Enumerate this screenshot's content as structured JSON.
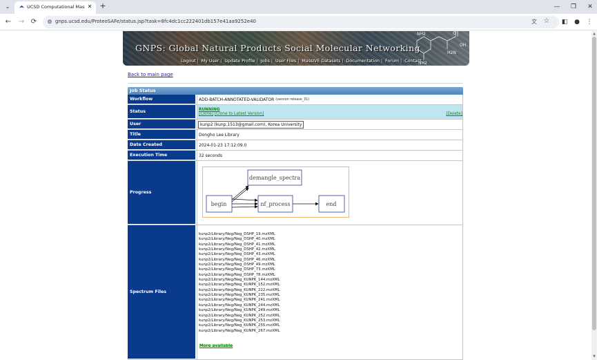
{
  "browser": {
    "tab_title": "UCSD Computational Mass Sp",
    "url": "gnps.ucsd.edu/ProteoSAFe/status.jsp?task=8fc4dc1cc222401db157e41aa9252e40"
  },
  "banner": {
    "title": "GNPS: Global Natural Products Social Molecular Networking",
    "nav": [
      "Logout",
      "My User",
      "Update Profile",
      "Jobs",
      "User Files",
      "MassIVE Datasets",
      "Documentation",
      "Forum",
      "Contact"
    ],
    "mol_labels": {
      "nh2_top": "NH2",
      "oh": "OH",
      "h2n": "H2N",
      "o": "O",
      "nh2_bottom": "NH2"
    }
  },
  "back_link": "Back to main page",
  "job": {
    "header": "Job Status",
    "rows": {
      "workflow": {
        "label": "Workflow",
        "value": "ADD-BATCH-ANNOTATED-VALIDATOR",
        "version": "(version release_31)"
      },
      "status": {
        "label": "Status",
        "state": "RUNNING",
        "clone": "[Clone]",
        "clone_latest": "[Clone to Latest Version]",
        "delete": "[Delete]"
      },
      "user": {
        "label": "User",
        "value": "kunp2 (kunp.1513@gmail.com), Korea University"
      },
      "title": {
        "label": "Title",
        "value": "Dongho Lee Library"
      },
      "date": {
        "label": "Date Created",
        "value": "2024-01-23 17:12:09.0"
      },
      "exec": {
        "label": "Execution Time",
        "value": "32 seconds"
      },
      "progress": {
        "label": "Progress",
        "nodes": {
          "begin": "begin",
          "demangle": "demangle_spectra",
          "process": "nf_process",
          "end": "end"
        }
      },
      "files": {
        "label": "Spectrum Files",
        "more": "More available"
      }
    }
  },
  "spectrum_files": [
    "kunp2/Library/Neg/Neg_DSHP_19.mzXML",
    "kunp2/Library/Neg/Neg_DSHP_40.mzXML",
    "kunp2/Library/Neg/Neg_DSHP_41.mzXML",
    "kunp2/Library/Neg/Neg_DSHP_42.mzXML",
    "kunp2/Library/Neg/Neg_DSHP_43.mzXML",
    "kunp2/Library/Neg/Neg_DSHP_46.mzXML",
    "kunp2/Library/Neg/Neg_DSHP_49.mzXML",
    "kunp2/Library/Neg/Neg_DSHP_73.mzXML",
    "kunp2/Library/Neg/Neg_DSHP_78.mzXML",
    "kunp2/Library/Neg/Neg_KUNPK_144.mzXML",
    "kunp2/Library/Neg/Neg_KUNPK_152.mzXML",
    "kunp2/Library/Neg/Neg_KUNPK_222.mzXML",
    "kunp2/Library/Neg/Neg_KUNPK_235.mzXML",
    "kunp2/Library/Neg/Neg_KUNPK_241.mzXML",
    "kunp2/Library/Neg/Neg_KUNPK_244.mzXML",
    "kunp2/Library/Neg/Neg_KUNPK_249.mzXML",
    "kunp2/Library/Neg/Neg_KUNPK_252.mzXML",
    "kunp2/Library/Neg/Neg_KUNPK_253.mzXML",
    "kunp2/Library/Neg/Neg_KUNPK_255.mzXML",
    "kunp2/Library/Neg/Neg_KUNPK_267.mzXML"
  ],
  "colors": {
    "label_bg": "#0a3a8c",
    "status_bg": "#bfe6f0",
    "running": "#0a8a0a",
    "highlight_box": "#d42222",
    "progress_border": "#f0b96a"
  }
}
